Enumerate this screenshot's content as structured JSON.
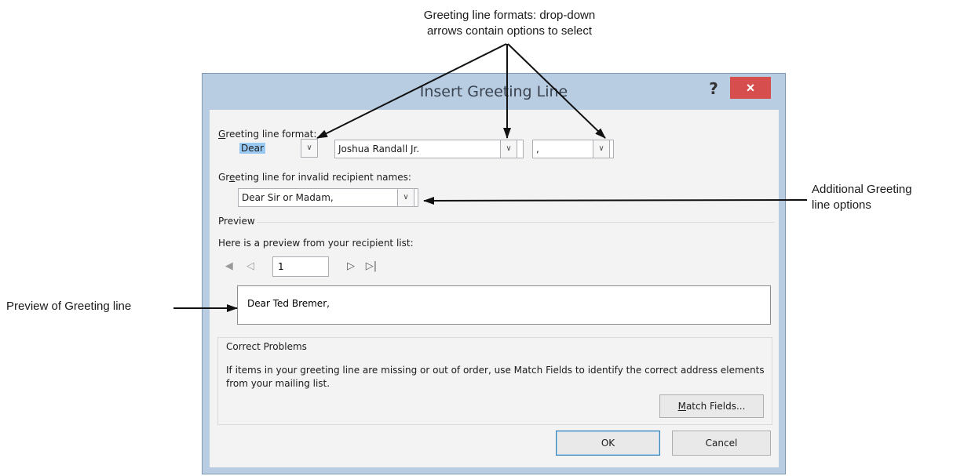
{
  "callouts": {
    "top_line1": "Greeting line formats: drop-down",
    "top_line2": "arrows contain options to select",
    "right_line1": "Additional Greeting",
    "right_line2": "line options",
    "left": "Preview of Greeting line"
  },
  "dialog": {
    "title": "Insert Greeting Line",
    "help": "?",
    "close": "×",
    "greeting_format_label": "Greeting line format:",
    "salutation": "Dear",
    "name_format": "Joshua Randall Jr.",
    "punctuation": ",",
    "invalid_label": "Greeting line for invalid recipient names:",
    "invalid_value": "Dear Sir or Madam,",
    "preview_heading": "Preview",
    "preview_label": "Here is a preview from your recipient list:",
    "record_number": "1",
    "preview_text": "Dear Ted Bremer,",
    "correct_problems_title": "Correct Problems",
    "correct_problems_text": "If items in your greeting line are missing or out of order, use Match Fields to identify the correct address elements from your mailing list.",
    "match_fields": "Match Fields...",
    "ok": "OK",
    "cancel": "Cancel"
  },
  "icons": {
    "dropdown": "chevron-down-icon",
    "first": "first-record-icon",
    "prev": "previous-record-icon",
    "next": "next-record-icon",
    "last": "last-record-icon"
  },
  "colors": {
    "frame": "#b9cde2",
    "close": "#d64e4e",
    "selection": "#99c8f2"
  }
}
